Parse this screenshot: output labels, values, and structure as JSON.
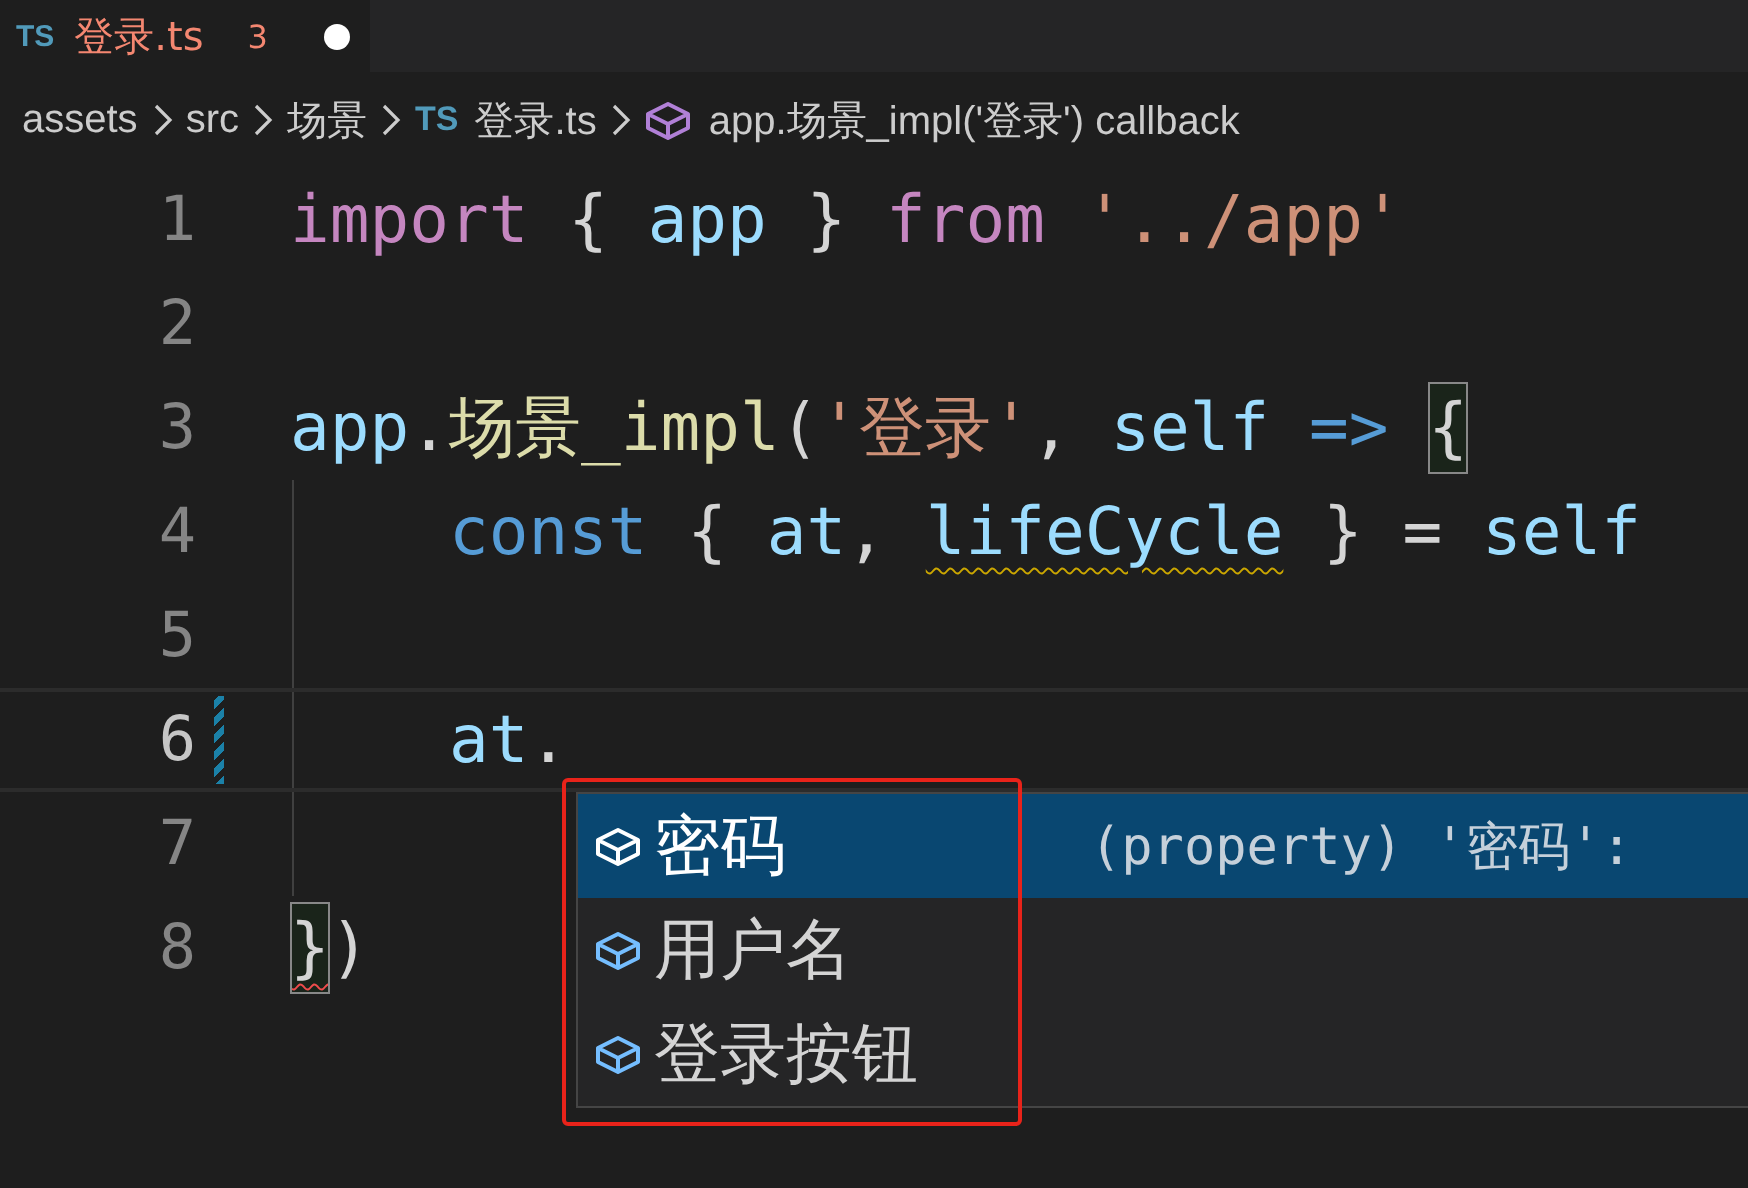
{
  "tab": {
    "icon": "TS",
    "label": "登录.ts",
    "problems": "3",
    "dirty": true
  },
  "breadcrumbs": [
    {
      "kind": "folder",
      "label": "assets"
    },
    {
      "kind": "folder",
      "label": "src"
    },
    {
      "kind": "folder",
      "label": "场景"
    },
    {
      "kind": "file",
      "icon": "TS",
      "label": "登录.ts"
    },
    {
      "kind": "symbol",
      "label": "app.场景_impl('登录') callback"
    }
  ],
  "lines": [
    {
      "number": "1",
      "active": false,
      "modified": false,
      "indented": false,
      "tokens": [
        {
          "kind": "keyword",
          "text": "import"
        },
        {
          "kind": "punct",
          "text": "{"
        },
        {
          "kind": "variable",
          "text": "app"
        },
        {
          "kind": "punct",
          "text": "}"
        },
        {
          "kind": "keyword",
          "text": "from"
        },
        {
          "kind": "string",
          "text": "'../app'"
        }
      ]
    },
    {
      "number": "2",
      "active": false,
      "modified": false
    },
    {
      "number": "3",
      "active": false,
      "modified": false,
      "indented": false,
      "tokens": [
        {
          "kind": "variable",
          "text": "app"
        },
        {
          "kind": "punct",
          "text": ".",
          "tight": true
        },
        {
          "kind": "function",
          "text": "场景_impl",
          "tight": true
        },
        {
          "kind": "punct",
          "text": "(",
          "tight": true
        },
        {
          "kind": "string",
          "text": "'登录'",
          "tight": true
        },
        {
          "kind": "punct",
          "text": ",",
          "tight": true
        },
        {
          "kind": "variable",
          "text": "self"
        },
        {
          "kind": "storage",
          "text": "=>"
        },
        {
          "kind": "punct",
          "text": "{",
          "matched": true
        }
      ]
    },
    {
      "number": "4",
      "active": false,
      "modified": false,
      "indented": true,
      "tokens": [
        {
          "kind": "storage",
          "text": "const"
        },
        {
          "kind": "punct",
          "text": "{"
        },
        {
          "kind": "variable",
          "text": "at"
        },
        {
          "kind": "punct",
          "text": ",",
          "tight": true
        },
        {
          "kind": "variable",
          "text": "lifeCycle",
          "warning": true
        },
        {
          "kind": "punct",
          "text": "}"
        },
        {
          "kind": "punct",
          "text": "="
        },
        {
          "kind": "variable",
          "text": "self"
        }
      ]
    },
    {
      "number": "5",
      "active": false,
      "modified": false
    },
    {
      "number": "6",
      "active": true,
      "modified": true,
      "indented": true,
      "tokens": [
        {
          "kind": "variable",
          "text": "at"
        },
        {
          "kind": "punct",
          "text": ".",
          "tight": true
        }
      ]
    },
    {
      "number": "7",
      "active": false,
      "modified": false
    },
    {
      "number": "8",
      "active": false,
      "modified": false,
      "indented": false,
      "tokens": [
        {
          "kind": "punct",
          "text": "}",
          "matched": true,
          "error": true
        },
        {
          "kind": "punct",
          "text": ")",
          "tight": true
        }
      ]
    }
  ],
  "suggestions": [
    {
      "label": "密码",
      "selected": true,
      "detail": "(property) '密码':"
    },
    {
      "label": "用户名",
      "selected": false
    },
    {
      "label": "登录按钮",
      "selected": false
    }
  ]
}
